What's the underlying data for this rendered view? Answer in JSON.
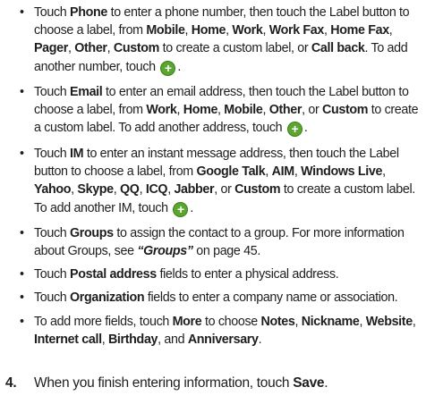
{
  "bullet_glyph": "•",
  "phone": {
    "a1": "Touch ",
    "k_phone": "Phone",
    "a2": " to enter a phone number, then touch the Label button to choose a label, from ",
    "k_mobile": "Mobile",
    "s1": ", ",
    "k_home": "Home",
    "s2": ", ",
    "k_work": "Work",
    "s3": ", ",
    "k_workfax": "Work Fax",
    "s4": ", ",
    "k_homefax": "Home Fax",
    "s5": ", ",
    "k_pager": "Pager",
    "s6": ", ",
    "k_other": "Other",
    "s7": ", ",
    "k_custom": "Custom",
    "a3": " to create a custom label, or ",
    "k_callback": "Call back",
    "a4": ". To add another number, touch ",
    "a5": "."
  },
  "email": {
    "a1": "Touch ",
    "k_email": "Email",
    "a2": " to enter an email address, then touch the Label button to choose a label, from ",
    "k_work": "Work",
    "s1": ", ",
    "k_home": "Home",
    "s2": ", ",
    "k_mobile": "Mobile",
    "s3": ", ",
    "k_other": "Other",
    "s4": ", or ",
    "k_custom": "Custom",
    "a3": " to create a custom label. To add another address, touch ",
    "a4": "."
  },
  "im": {
    "a1": "Touch ",
    "k_im": "IM",
    "a2": " to enter an instant message address, then touch the Label button to choose a label, from ",
    "k_gtalk": "Google Talk",
    "s1": ", ",
    "k_aim": "AIM",
    "s2": ", ",
    "k_wlive": "Windows Live",
    "s3": ", ",
    "k_yahoo": "Yahoo",
    "s4": ", ",
    "k_skype": "Skype",
    "s5": ", ",
    "k_qq": "QQ",
    "s6": ", ",
    "k_icq": "ICQ",
    "s7": ", ",
    "k_jabber": "Jabber",
    "s8": ", or ",
    "k_custom": "Custom",
    "a3": " to create a custom label. To add another IM, touch ",
    "a4": "."
  },
  "groups": {
    "a1": "Touch ",
    "k_groups": "Groups",
    "a2": " to assign the contact to a group. For more information about Groups, see ",
    "ref": "“Groups”",
    "a3": " on page 45."
  },
  "postal": {
    "a1": "Touch ",
    "k_postal": "Postal address",
    "a2": " fields to enter a physical address."
  },
  "org": {
    "a1": "Touch ",
    "k_org": "Organization",
    "a2": " fields to enter a company name or association."
  },
  "more": {
    "a1": "To add more fields, touch ",
    "k_more": "More",
    "a2": " to choose ",
    "k_notes": "Notes",
    "s1": ", ",
    "k_nickname": "Nickname",
    "s2": ", ",
    "k_website": "Website",
    "s3": ", ",
    "k_icall": "Internet call",
    "s4": ", ",
    "k_birthday": "Birthday",
    "s5": ", and ",
    "k_anniv": "Anniversary",
    "a3": "."
  },
  "step4": {
    "number": "4.",
    "a1": "When you finish entering information, touch ",
    "k_save": "Save",
    "a2": "."
  },
  "plus_glyph": "+",
  "colors": {
    "add_button_green": "#5aa62e",
    "text": "#1e1e1e"
  },
  "icons": {
    "add": "green-circle-plus-icon"
  }
}
